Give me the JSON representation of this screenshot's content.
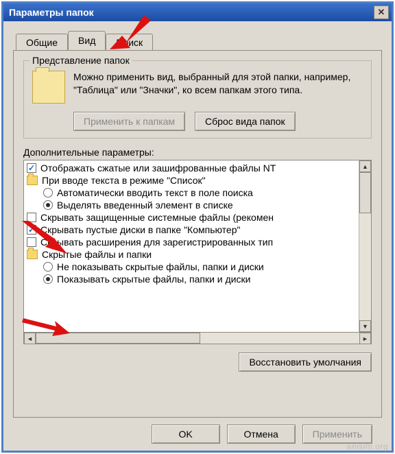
{
  "window": {
    "title": "Параметры папок",
    "close_symbol": "✕"
  },
  "tabs": {
    "general": "Общие",
    "view": "Вид",
    "search": "Поиск"
  },
  "folder_group": {
    "caption": "Представление папок",
    "desc": "Можно применить вид, выбранный для этой папки, например, \"Таблица\" или \"Значки\", ко всем папкам этого типа.",
    "apply_btn": "Применить к папкам",
    "reset_btn": "Сброс вида папок"
  },
  "advanced": {
    "label": "Дополнительные параметры:",
    "items": [
      {
        "type": "check",
        "checked": true,
        "indent": 0,
        "text": "Отображать сжатые или зашифрованные файлы NT"
      },
      {
        "type": "folder",
        "indent": 0,
        "text": "При вводе текста в режиме \"Список\""
      },
      {
        "type": "radio",
        "checked": false,
        "indent": 1,
        "text": "Автоматически вводить текст в поле поиска"
      },
      {
        "type": "radio",
        "checked": true,
        "indent": 1,
        "text": "Выделять введенный элемент в списке"
      },
      {
        "type": "check",
        "checked": false,
        "indent": 0,
        "text": "Скрывать защищенные системные файлы (рекомен"
      },
      {
        "type": "check",
        "checked": true,
        "indent": 0,
        "text": "Скрывать пустые диски в папке \"Компьютер\""
      },
      {
        "type": "check",
        "checked": false,
        "indent": 0,
        "text": "Скрывать расширения для зарегистрированных тип"
      },
      {
        "type": "folder",
        "indent": 0,
        "text": "Скрытые файлы и папки"
      },
      {
        "type": "radio",
        "checked": false,
        "indent": 1,
        "text": "Не показывать скрытые файлы, папки и диски"
      },
      {
        "type": "radio",
        "checked": true,
        "indent": 1,
        "text": "Показывать скрытые файлы, папки и диски"
      }
    ],
    "restore_btn": "Восстановить умолчания"
  },
  "buttons": {
    "ok": "OK",
    "cancel": "Отмена",
    "apply": "Применить"
  },
  "watermark": "anisim.org"
}
